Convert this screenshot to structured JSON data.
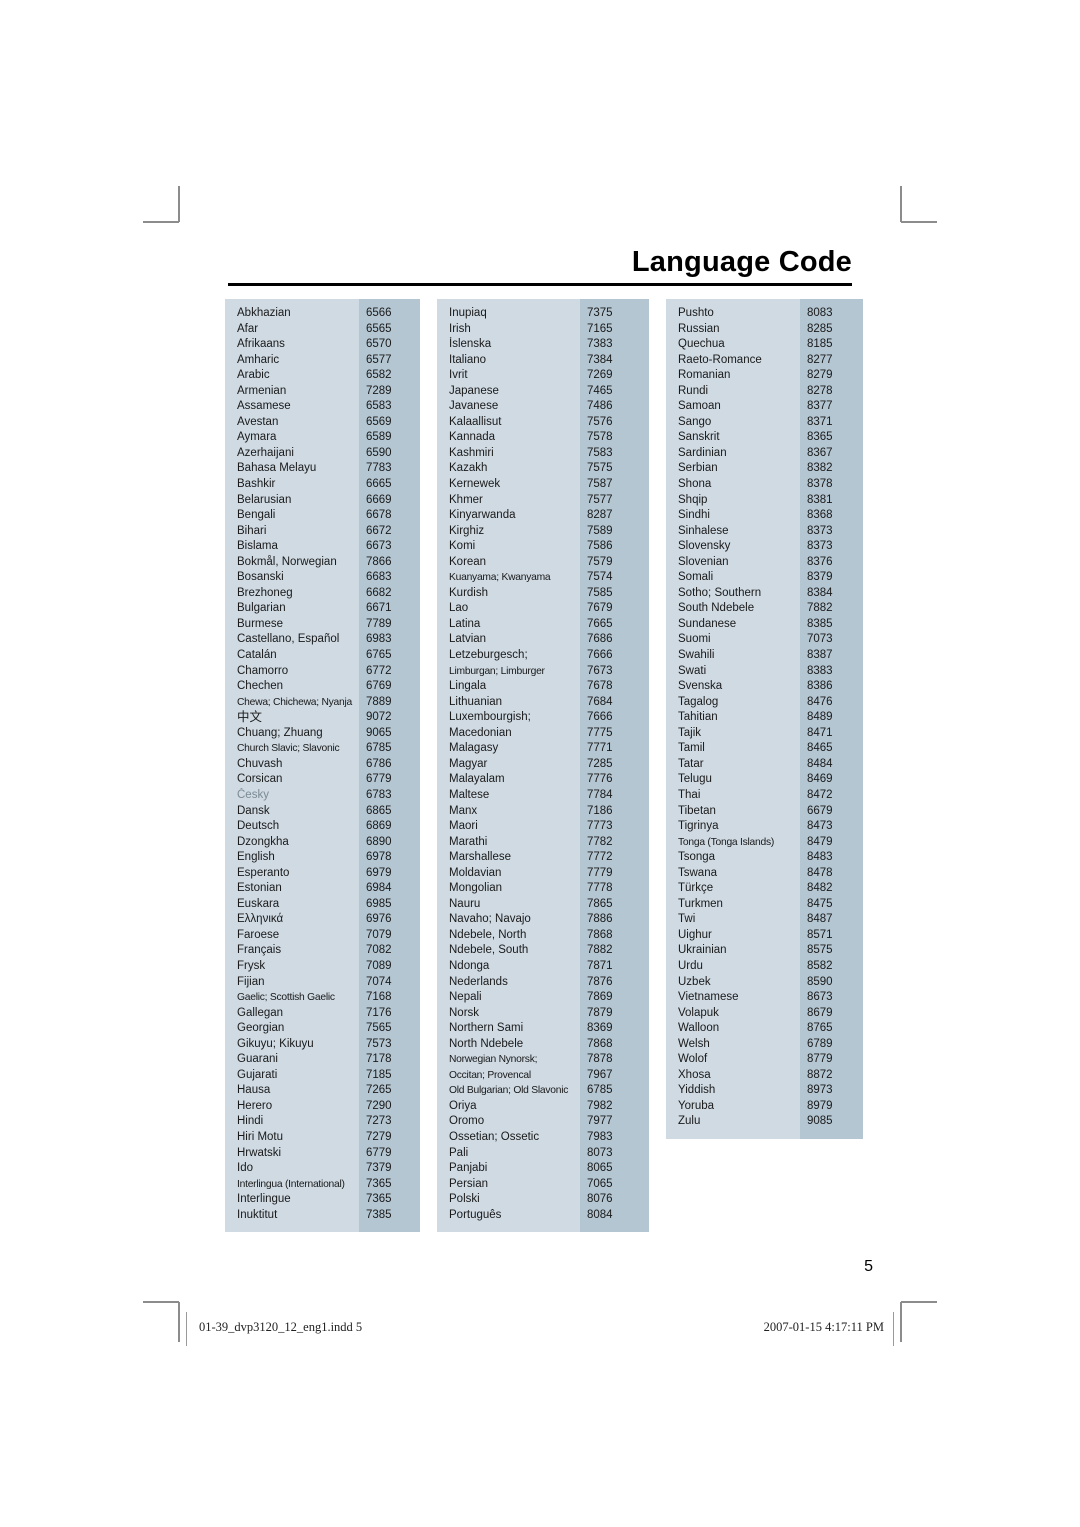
{
  "page": {
    "title": "Language Code",
    "folio": "5",
    "footer_left": "01-39_dvp3120_12_eng1.indd   5",
    "footer_right": "2007-01-15   4:17:11 PM",
    "accent_name_bg": "#cfdae3",
    "accent_code_bg": "#b4c6d2",
    "text_color": "#1a1a1a"
  },
  "columns": [
    {
      "id": "column-1",
      "rows": [
        {
          "name": "Abkhazian",
          "code": "6566"
        },
        {
          "name": "Afar",
          "code": "6565"
        },
        {
          "name": "Afrikaans",
          "code": "6570"
        },
        {
          "name": "Amharic",
          "code": "6577"
        },
        {
          "name": "Arabic",
          "code": "6582"
        },
        {
          "name": "Armenian",
          "code": "7289"
        },
        {
          "name": "Assamese",
          "code": "6583"
        },
        {
          "name": "Avestan",
          "code": "6569"
        },
        {
          "name": "Aymara",
          "code": "6589"
        },
        {
          "name": "Azerhaijani",
          "code": "6590"
        },
        {
          "name": "Bahasa Melayu",
          "code": "7783"
        },
        {
          "name": "Bashkir",
          "code": "6665"
        },
        {
          "name": "Belarusian",
          "code": "6669"
        },
        {
          "name": "Bengali",
          "code": "6678"
        },
        {
          "name": "Bihari",
          "code": "6672"
        },
        {
          "name": "Bislama",
          "code": "6673"
        },
        {
          "name": "Bokmål, Norwegian",
          "code": "7866"
        },
        {
          "name": "Bosanski",
          "code": "6683"
        },
        {
          "name": "Brezhoneg",
          "code": "6682"
        },
        {
          "name": "Bulgarian",
          "code": "6671"
        },
        {
          "name": "Burmese",
          "code": "7789"
        },
        {
          "name": "Castellano, Español",
          "code": "6983"
        },
        {
          "name": "Catalán",
          "code": "6765"
        },
        {
          "name": "Chamorro",
          "code": "6772"
        },
        {
          "name": "Chechen",
          "code": "6769"
        },
        {
          "name": "Chewa; Chichewa; Nyanja",
          "code": "7889",
          "style": "tight"
        },
        {
          "name": "中文",
          "code": "9072",
          "style": "cjk"
        },
        {
          "name": "Chuang; Zhuang",
          "code": "9065"
        },
        {
          "name": "Church Slavic; Slavonic",
          "code": "6785",
          "style": "tight"
        },
        {
          "name": "Chuvash",
          "code": "6786"
        },
        {
          "name": "Corsican",
          "code": "6779"
        },
        {
          "name": "Česky",
          "code": "6783",
          "style": "muted"
        },
        {
          "name": "Dansk",
          "code": "6865"
        },
        {
          "name": "Deutsch",
          "code": "6869"
        },
        {
          "name": "Dzongkha",
          "code": "6890"
        },
        {
          "name": "English",
          "code": "6978"
        },
        {
          "name": "Esperanto",
          "code": "6979"
        },
        {
          "name": "Estonian",
          "code": "6984"
        },
        {
          "name": "Euskara",
          "code": "6985"
        },
        {
          "name": "Ελληνικά",
          "code": "6976"
        },
        {
          "name": "Faroese",
          "code": "7079"
        },
        {
          "name": "Français",
          "code": "7082"
        },
        {
          "name": "Frysk",
          "code": "7089"
        },
        {
          "name": "Fijian",
          "code": "7074"
        },
        {
          "name": "Gaelic; Scottish Gaelic",
          "code": "7168",
          "style": "tight"
        },
        {
          "name": "Gallegan",
          "code": "7176"
        },
        {
          "name": "Georgian",
          "code": "7565"
        },
        {
          "name": "Gikuyu; Kikuyu",
          "code": "7573"
        },
        {
          "name": "Guarani",
          "code": "7178"
        },
        {
          "name": "Gujarati",
          "code": "7185"
        },
        {
          "name": "Hausa",
          "code": "7265"
        },
        {
          "name": "Herero",
          "code": "7290"
        },
        {
          "name": "Hindi",
          "code": "7273"
        },
        {
          "name": "Hiri Motu",
          "code": "7279"
        },
        {
          "name": "Hrwatski",
          "code": "6779"
        },
        {
          "name": "Ido",
          "code": "7379"
        },
        {
          "name": "Interlingua (International)",
          "code": "7365",
          "style": "tight"
        },
        {
          "name": "Interlingue",
          "code": "7365"
        },
        {
          "name": "Inuktitut",
          "code": "7385"
        }
      ]
    },
    {
      "id": "column-2",
      "rows": [
        {
          "name": "Inupiaq",
          "code": "7375"
        },
        {
          "name": "Irish",
          "code": "7165"
        },
        {
          "name": "Íslenska",
          "code": "7383"
        },
        {
          "name": "Italiano",
          "code": "7384"
        },
        {
          "name": "Ivrit",
          "code": "7269"
        },
        {
          "name": "Japanese",
          "code": "7465"
        },
        {
          "name": "Javanese",
          "code": "7486"
        },
        {
          "name": "Kalaallisut",
          "code": "7576"
        },
        {
          "name": "Kannada",
          "code": "7578"
        },
        {
          "name": "Kashmiri",
          "code": "7583"
        },
        {
          "name": "Kazakh",
          "code": "7575"
        },
        {
          "name": "Kernewek",
          "code": "7587"
        },
        {
          "name": "Khmer",
          "code": "7577"
        },
        {
          "name": "Kinyarwanda",
          "code": "8287"
        },
        {
          "name": "Kirghiz",
          "code": "7589"
        },
        {
          "name": "Komi",
          "code": "7586"
        },
        {
          "name": "Korean",
          "code": "7579"
        },
        {
          "name": "Kuanyama; Kwanyama",
          "code": "7574",
          "style": "tight"
        },
        {
          "name": "Kurdish",
          "code": "7585"
        },
        {
          "name": "Lao",
          "code": "7679"
        },
        {
          "name": "Latina",
          "code": "7665"
        },
        {
          "name": "Latvian",
          "code": "7686"
        },
        {
          "name": "Letzeburgesch;",
          "code": "7666"
        },
        {
          "name": "Limburgan; Limburger",
          "code": "7673",
          "style": "tight"
        },
        {
          "name": "Lingala",
          "code": "7678"
        },
        {
          "name": "Lithuanian",
          "code": "7684"
        },
        {
          "name": "Luxembourgish;",
          "code": "7666"
        },
        {
          "name": "Macedonian",
          "code": "7775"
        },
        {
          "name": "Malagasy",
          "code": "7771"
        },
        {
          "name": "Magyar",
          "code": "7285"
        },
        {
          "name": "Malayalam",
          "code": "7776"
        },
        {
          "name": "Maltese",
          "code": "7784"
        },
        {
          "name": "Manx",
          "code": "7186"
        },
        {
          "name": "Maori",
          "code": "7773"
        },
        {
          "name": "Marathi",
          "code": "7782"
        },
        {
          "name": "Marshallese",
          "code": "7772"
        },
        {
          "name": "Moldavian",
          "code": "7779"
        },
        {
          "name": "Mongolian",
          "code": "7778"
        },
        {
          "name": "Nauru",
          "code": "7865"
        },
        {
          "name": "Navaho; Navajo",
          "code": "7886"
        },
        {
          "name": "Ndebele, North",
          "code": "7868"
        },
        {
          "name": "Ndebele, South",
          "code": "7882"
        },
        {
          "name": "Ndonga",
          "code": "7871"
        },
        {
          "name": "Nederlands",
          "code": "7876"
        },
        {
          "name": "Nepali",
          "code": "7869"
        },
        {
          "name": "Norsk",
          "code": "7879"
        },
        {
          "name": "Northern Sami",
          "code": "8369"
        },
        {
          "name": "North Ndebele",
          "code": "7868"
        },
        {
          "name": "Norwegian Nynorsk;",
          "code": "7878",
          "style": "tight"
        },
        {
          "name": "Occitan; Provencal",
          "code": "7967",
          "style": "tight"
        },
        {
          "name": "Old Bulgarian; Old Slavonic",
          "code": "6785",
          "style": "tight"
        },
        {
          "name": "Oriya",
          "code": "7982"
        },
        {
          "name": "Oromo",
          "code": "7977"
        },
        {
          "name": "Ossetian; Ossetic",
          "code": "7983"
        },
        {
          "name": "Pali",
          "code": "8073"
        },
        {
          "name": "Panjabi",
          "code": "8065"
        },
        {
          "name": "Persian",
          "code": "7065"
        },
        {
          "name": "Polski",
          "code": "8076"
        },
        {
          "name": "Português",
          "code": "8084"
        }
      ]
    },
    {
      "id": "column-3",
      "rows": [
        {
          "name": "Pushto",
          "code": "8083"
        },
        {
          "name": "Russian",
          "code": "8285"
        },
        {
          "name": "Quechua",
          "code": "8185"
        },
        {
          "name": "Raeto-Romance",
          "code": "8277"
        },
        {
          "name": "Romanian",
          "code": "8279"
        },
        {
          "name": "Rundi",
          "code": "8278"
        },
        {
          "name": "Samoan",
          "code": "8377"
        },
        {
          "name": "Sango",
          "code": "8371"
        },
        {
          "name": "Sanskrit",
          "code": "8365"
        },
        {
          "name": "Sardinian",
          "code": "8367"
        },
        {
          "name": "Serbian",
          "code": "8382"
        },
        {
          "name": "Shona",
          "code": "8378"
        },
        {
          "name": "Shqip",
          "code": "8381"
        },
        {
          "name": "Sindhi",
          "code": "8368"
        },
        {
          "name": "Sinhalese",
          "code": "8373"
        },
        {
          "name": "Slovensky",
          "code": "8373"
        },
        {
          "name": "Slovenian",
          "code": "8376"
        },
        {
          "name": "Somali",
          "code": "8379"
        },
        {
          "name": "Sotho; Southern",
          "code": "8384"
        },
        {
          "name": "South Ndebele",
          "code": "7882"
        },
        {
          "name": "Sundanese",
          "code": "8385"
        },
        {
          "name": "Suomi",
          "code": "7073"
        },
        {
          "name": "Swahili",
          "code": "8387"
        },
        {
          "name": "Swati",
          "code": "8383"
        },
        {
          "name": "Svenska",
          "code": "8386"
        },
        {
          "name": "Tagalog",
          "code": "8476"
        },
        {
          "name": "Tahitian",
          "code": "8489"
        },
        {
          "name": "Tajik",
          "code": "8471"
        },
        {
          "name": "Tamil",
          "code": "8465"
        },
        {
          "name": "Tatar",
          "code": "8484"
        },
        {
          "name": "Telugu",
          "code": "8469"
        },
        {
          "name": "Thai",
          "code": "8472"
        },
        {
          "name": "Tibetan",
          "code": "6679"
        },
        {
          "name": "Tigrinya",
          "code": "8473"
        },
        {
          "name": "Tonga (Tonga Islands)",
          "code": "8479",
          "style": "tight"
        },
        {
          "name": "Tsonga",
          "code": "8483"
        },
        {
          "name": "Tswana",
          "code": "8478"
        },
        {
          "name": "Türkçe",
          "code": "8482"
        },
        {
          "name": "Turkmen",
          "code": "8475"
        },
        {
          "name": "Twi",
          "code": "8487"
        },
        {
          "name": "Uighur",
          "code": "8571"
        },
        {
          "name": "Ukrainian",
          "code": "8575"
        },
        {
          "name": "Urdu",
          "code": "8582"
        },
        {
          "name": "Uzbek",
          "code": "8590"
        },
        {
          "name": "Vietnamese",
          "code": "8673"
        },
        {
          "name": "Volapuk",
          "code": "8679"
        },
        {
          "name": "Walloon",
          "code": "8765"
        },
        {
          "name": "Welsh",
          "code": "6789"
        },
        {
          "name": "Wolof",
          "code": "8779"
        },
        {
          "name": "Xhosa",
          "code": "8872"
        },
        {
          "name": "Yiddish",
          "code": "8973"
        },
        {
          "name": "Yoruba",
          "code": "8979"
        },
        {
          "name": "Zulu",
          "code": "9085"
        }
      ]
    }
  ]
}
